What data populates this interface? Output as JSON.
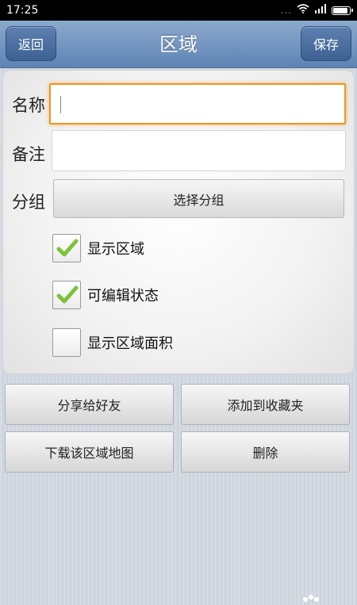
{
  "status_bar": {
    "time": "17:25",
    "dots": "...",
    "signal": "ıll"
  },
  "header": {
    "title": "区域",
    "back_label": "返回",
    "save_label": "保存"
  },
  "form": {
    "name_label": "名称",
    "name_value": "",
    "note_label": "备注",
    "note_value": "",
    "group_label": "分组",
    "group_button": "选择分组",
    "checkboxes": [
      {
        "label": "显示区域",
        "checked": true
      },
      {
        "label": "可编辑状态",
        "checked": true
      },
      {
        "label": "显示区域面积",
        "checked": false
      }
    ]
  },
  "actions": {
    "share": "分享给好友",
    "favorite": "添加到收藏夹",
    "download_map": "下载该区域地图",
    "delete": "删除"
  },
  "colors": {
    "accent": "#f0951e",
    "title_bar": "#6f91be",
    "check": "#7cc23a"
  }
}
